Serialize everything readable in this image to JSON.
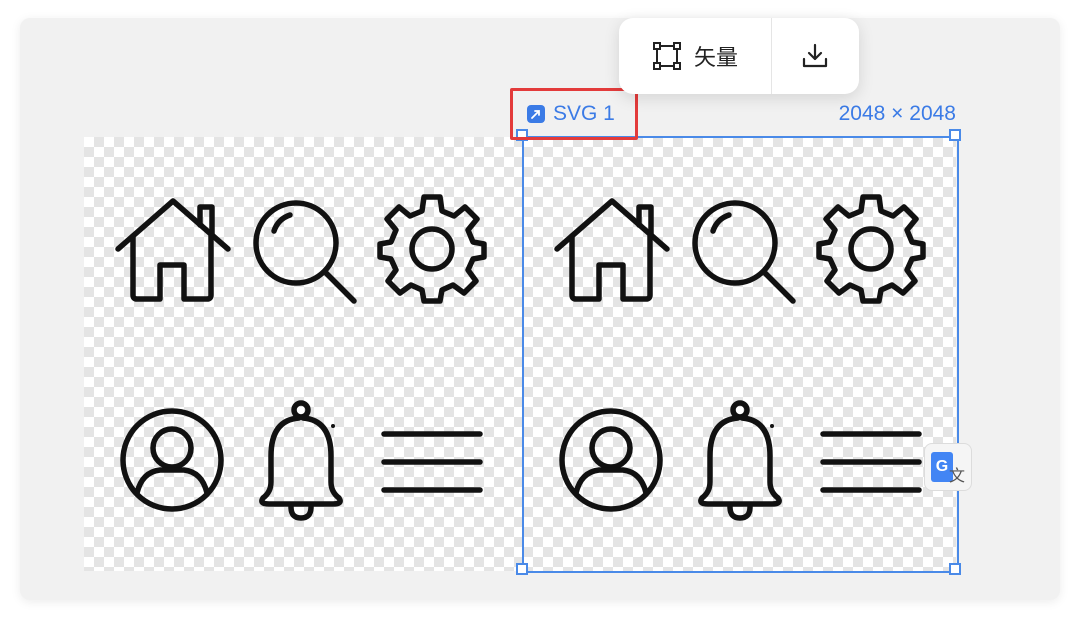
{
  "toolbar": {
    "vector_label": "矢量",
    "vector_icon": "vector-frame-icon",
    "download_icon": "download-icon"
  },
  "selection": {
    "layer_name": "SVG 1",
    "layer_icon": "svg-layer-icon",
    "dimensions": "2048 × 2048"
  },
  "icon_grid": [
    "home-icon",
    "search-icon",
    "gear-icon",
    "user-icon",
    "bell-icon",
    "menu-icon"
  ],
  "translate_widget": {
    "g_label": "G",
    "wen_label": "文"
  },
  "colors": {
    "accent": "#3b7be6",
    "highlight_border": "#e33b3b",
    "icon_stroke": "#111111"
  }
}
